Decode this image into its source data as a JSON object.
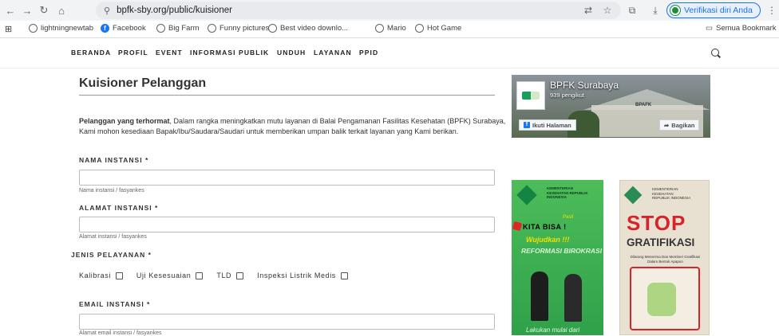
{
  "browser": {
    "url": "bpfk-sby.org/public/kuisioner",
    "verify_label": "Verifikasi diri Anda",
    "bookmarks": [
      "lightningnewtab",
      "Facebook",
      "Big Farm",
      "Funny pictures",
      "Best video downlo...",
      "Mario",
      "Hot Game"
    ],
    "all_bookmarks": "Semua Bookmark"
  },
  "nav": {
    "items": [
      "BERANDA",
      "PROFIL",
      "EVENT",
      "INFORMASI PUBLIK",
      "UNDUH",
      "LAYANAN",
      "PPID"
    ]
  },
  "form": {
    "title": "Kuisioner Pelanggan",
    "intro_bold": "Pelanggan yang terhormat",
    "intro_rest": ", Dalam rangka meningkatkan mutu layanan di Balai Pengamanan Fasilitas Kesehatan (BPFK) Surabaya, Kami mohon kesediaan Bapak/Ibu/Saudara/Saudari untuk memberikan umpan balik terkait layanan yang Kami berikan.",
    "nama_label": "NAMA INSTANSI *",
    "nama_help": "Nama instansi / fasyankes",
    "alamat_label": "ALAMAT INSTANSI *",
    "alamat_help": "Alamat instansi / fasyankes",
    "jenis_label": "JENIS PELAYANAN *",
    "jenis_options": [
      "Kalibrasi",
      "Uji Kesesuaian",
      "TLD",
      "Inspeksi Listrik Medis"
    ],
    "email_label": "EMAIL INSTANSI *",
    "email_help": "Alamat email instansi / fasyankes"
  },
  "facebook": {
    "page_name": "BPFK Surabaya",
    "followers": "939 pengikut",
    "follow_label": "Ikuti Halaman",
    "share_label": "Bagikan",
    "building_sign": "BPAFK"
  },
  "banner_kita_bisa": {
    "org": "KEMENTERIAN KESEHATAN REPUBLIK INDONESIA",
    "pasti": "Pasti",
    "kita_bisa": "KITA BISA !",
    "wujudkan": "Wujudkan !!!",
    "reformasi": "REFORMASI BIROKRASI",
    "footer": "Lakukan mulai dari"
  },
  "banner_stop": {
    "org": "KEMENTERIAN KESEHATAN REPUBLIK INDONESIA",
    "stop": "STOP",
    "gratifikasi": "GRATIFIKASI",
    "subtitle": "Dilarang Menerima Dan Memberi Gratifikasi Dalam Bentuk Apapun"
  }
}
